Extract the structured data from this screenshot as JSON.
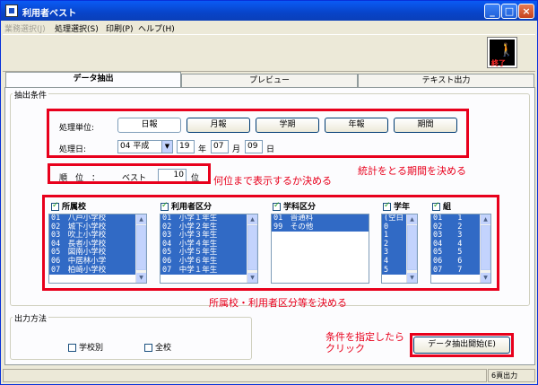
{
  "window": {
    "title": "利用者ベスト"
  },
  "menu": {
    "items": [
      {
        "label": "業務選択(J)",
        "disabled": true
      },
      {
        "label": "処理選択(S)",
        "disabled": false
      },
      {
        "label": "印刷(P)",
        "disabled": false
      },
      {
        "label": "ヘルプ(H)",
        "disabled": false
      }
    ]
  },
  "toolbar": {
    "exit_label": "終了"
  },
  "tabs": [
    "データ抽出",
    "プレビュー",
    "テキスト出力"
  ],
  "extraction": {
    "group_label": "抽出条件",
    "unit_label": "処理単位:",
    "unit_buttons": [
      "日報",
      "月報",
      "学期",
      "年報",
      "期間"
    ],
    "date_label": "処理日:",
    "era": "04 平成",
    "year": "19",
    "year_suffix": "年",
    "month": "07",
    "month_suffix": "月",
    "day": "09",
    "day_suffix": "日",
    "rank_label": "順　位　：",
    "best_label": "ベスト",
    "rank_value": "10",
    "rank_suffix": "位"
  },
  "lists": {
    "school": {
      "header": "所属校",
      "rows": [
        "01　八戸小学校",
        "02　城下小学校",
        "03　吹上小学校",
        "04　長者小学校",
        "05　図南小学校",
        "06　中居林小学",
        "07　柏崎小学校"
      ]
    },
    "user_class": {
      "header": "利用者区分",
      "rows": [
        "01　小学１年生",
        "02　小学２年生",
        "03　小学３年生",
        "04　小学４年生",
        "05　小学５年生",
        "06　小学６年生",
        "07　中学１年生"
      ]
    },
    "subject": {
      "header": "学科区分",
      "rows": [
        "01　普通科",
        "99　その他"
      ]
    },
    "grade": {
      "header": "学年",
      "rows": [
        "(空白",
        "0",
        "1",
        "2",
        "3",
        "4",
        "5"
      ]
    },
    "class_group": {
      "header": "組",
      "rows": [
        "01　　1",
        "02　　2",
        "03　　3",
        "04　　4",
        "05　　5",
        "06　　6",
        "07　　7"
      ]
    }
  },
  "output": {
    "group_label": "出力方法",
    "by_school": "学校別",
    "all_schools": "全校"
  },
  "start_button": "データ抽出開始(E)",
  "annotations": {
    "period": "統計をとる期間を決める",
    "rank": "何位まで表示するか決める",
    "lists": "所属校・利用者区分等を決める",
    "click": "条件を指定したら\nクリック"
  },
  "status": {
    "pages": "6頁出力"
  }
}
